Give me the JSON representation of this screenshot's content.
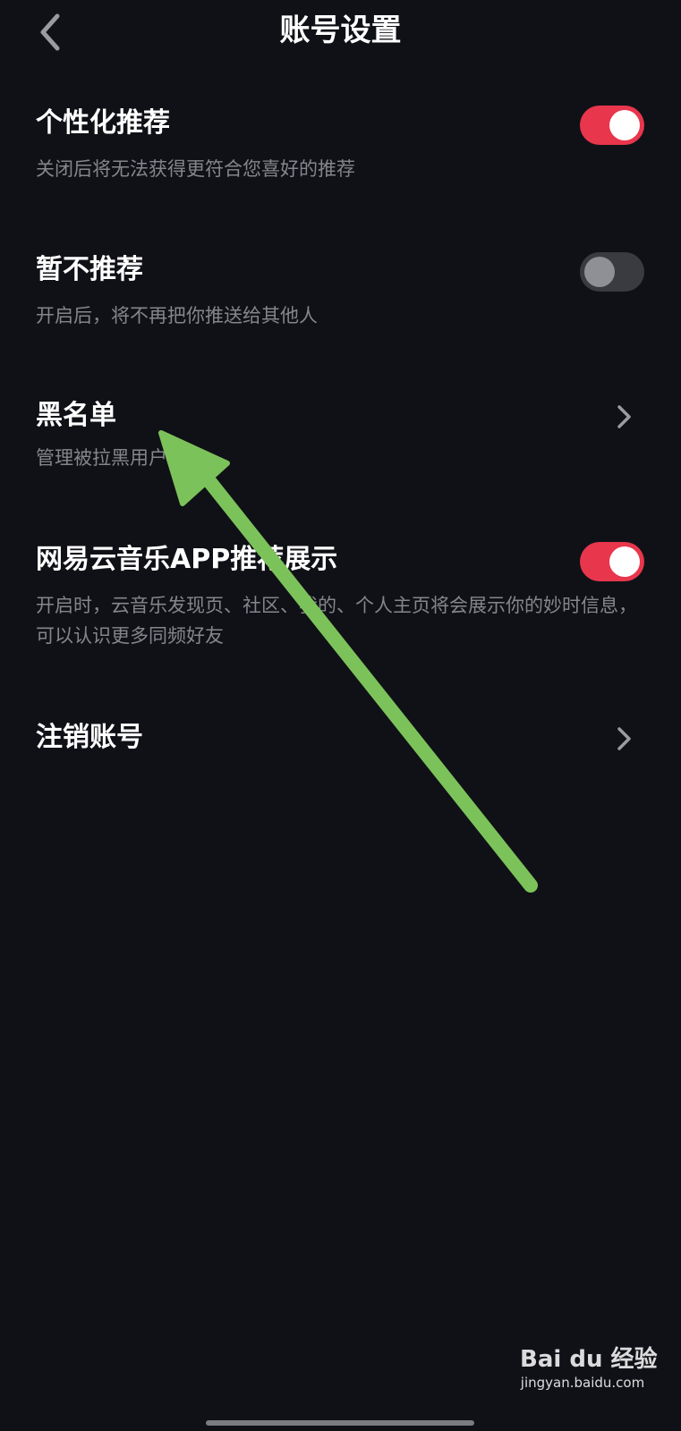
{
  "header": {
    "title": "账号设置",
    "back_icon": "chevron-left-icon"
  },
  "settings": [
    {
      "title": "个性化推荐",
      "description": "关闭后将无法获得更符合您喜好的推荐",
      "control": "toggle",
      "enabled": true
    },
    {
      "title": "暂不推荐",
      "description": "开启后，将不再把你推送给其他人",
      "control": "toggle",
      "enabled": false
    },
    {
      "title": "黑名单",
      "description": "管理被拉黑用户",
      "control": "chevron-right-icon"
    },
    {
      "title": "网易云音乐APP推荐展示",
      "description": "开启时，云音乐发现页、社区、我的、个人主页将会展示你的妙时信息，可以认识更多同频好友",
      "control": "toggle",
      "enabled": true
    },
    {
      "title": "注销账号",
      "control": "chevron-right-icon"
    }
  ],
  "colors": {
    "background": "#101117",
    "toggle_on": "#e8364d",
    "toggle_off": "#3a3b41",
    "annotation_arrow": "#7cc25a"
  },
  "watermark": {
    "logo": "Bai du 经验",
    "url": "jingyan.baidu.com"
  }
}
